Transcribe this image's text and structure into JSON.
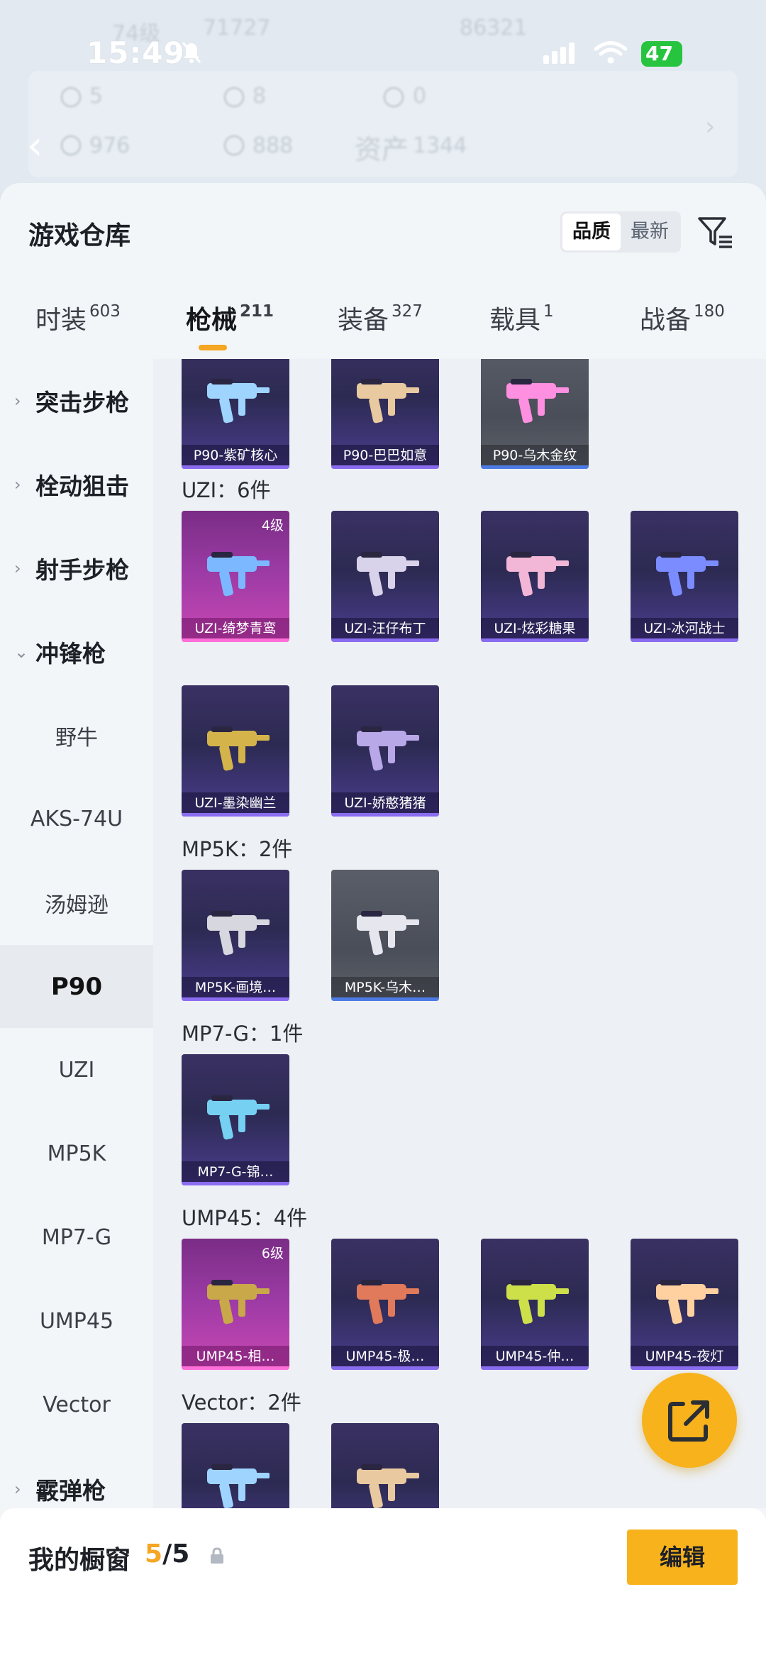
{
  "background": {
    "faded_texts": [
      "74级",
      "71727",
      "86321",
      "5",
      "8",
      "0",
      "976",
      "888",
      "资产",
      "1344"
    ]
  },
  "status_bar": {
    "time": "15:49",
    "battery": "47"
  },
  "header": {
    "title": "游戏仓库",
    "sort_options": [
      "品质",
      "最新"
    ],
    "active_sort": "品质"
  },
  "tabs": [
    {
      "label": "时装",
      "count": "603"
    },
    {
      "label": "枪械",
      "count": "211"
    },
    {
      "label": "装备",
      "count": "327"
    },
    {
      "label": "载具",
      "count": "1"
    },
    {
      "label": "战备",
      "count": "180"
    }
  ],
  "active_tab": "枪械",
  "sidebar": {
    "items": [
      {
        "label": "突击步枪",
        "type": "group",
        "expanded": false
      },
      {
        "label": "栓动狙击",
        "type": "group",
        "expanded": false
      },
      {
        "label": "射手步枪",
        "type": "group",
        "expanded": false
      },
      {
        "label": "冲锋枪",
        "type": "group",
        "expanded": true
      },
      {
        "label": "野牛",
        "type": "sub"
      },
      {
        "label": "AKS-74U",
        "type": "sub"
      },
      {
        "label": "汤姆逊",
        "type": "sub"
      },
      {
        "label": "P90",
        "type": "sub",
        "active": true
      },
      {
        "label": "UZI",
        "type": "sub"
      },
      {
        "label": "MP5K",
        "type": "sub"
      },
      {
        "label": "MP7-G",
        "type": "sub"
      },
      {
        "label": "UMP45",
        "type": "sub"
      },
      {
        "label": "Vector",
        "type": "sub"
      },
      {
        "label": "霰弹枪",
        "type": "group",
        "expanded": false
      }
    ]
  },
  "content": {
    "p90_cards": [
      {
        "name": "P90-紫矿核心",
        "rarity": "purple"
      },
      {
        "name": "P90-巴巴如意",
        "rarity": "purple"
      },
      {
        "name": "P90-乌木金纹",
        "rarity": "gray"
      }
    ],
    "sections": [
      {
        "title": "UZI：6件",
        "cards": [
          {
            "name": "UZI-绮梦青鸾",
            "rarity": "pink",
            "level": "4级"
          },
          {
            "name": "UZI-汪仔布丁",
            "rarity": "purple"
          },
          {
            "name": "UZI-炫彩糖果",
            "rarity": "purple"
          },
          {
            "name": "UZI-冰河战士",
            "rarity": "purple"
          },
          {
            "name": "UZI-墨染幽兰",
            "rarity": "purple"
          },
          {
            "name": "UZI-娇憨猪猪",
            "rarity": "purple"
          }
        ]
      },
      {
        "title": "MP5K：2件",
        "cards": [
          {
            "name": "MP5K-画境…",
            "rarity": "purple"
          },
          {
            "name": "MP5K-乌木…",
            "rarity": "gray"
          }
        ]
      },
      {
        "title": "MP7-G：1件",
        "cards": [
          {
            "name": "MP7-G-锦…",
            "rarity": "purple"
          }
        ]
      },
      {
        "title": "UMP45：4件",
        "cards": [
          {
            "name": "UMP45-相…",
            "rarity": "pink",
            "level": "6级"
          },
          {
            "name": "UMP45-极…",
            "rarity": "purple"
          },
          {
            "name": "UMP45-仲…",
            "rarity": "purple"
          },
          {
            "name": "UMP45-夜灯",
            "rarity": "purple"
          }
        ]
      },
      {
        "title": "Vector：2件",
        "cards": [
          {
            "name": "",
            "rarity": "purple"
          },
          {
            "name": "",
            "rarity": "purple"
          }
        ]
      }
    ]
  },
  "showcase": {
    "label": "我的橱窗",
    "current": "5",
    "total": "/5"
  },
  "edit_button": "编辑",
  "colors": {
    "accent": "#f7b21c",
    "pink_rarity": "#c948b5",
    "purple_rarity": "#4b3d8f",
    "gray_rarity": "#5a5e68"
  }
}
